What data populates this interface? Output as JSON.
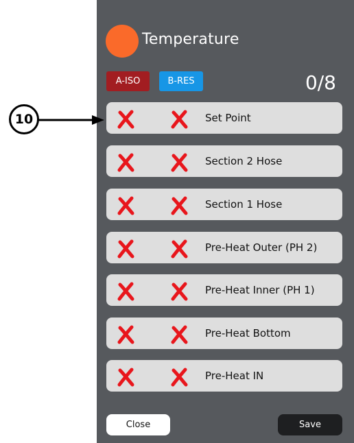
{
  "header": {
    "title": "Temperature",
    "accent_color": "#fa6a2a"
  },
  "badges": [
    {
      "label": "A-ISO",
      "color": "#a21d21"
    },
    {
      "label": "B-RES",
      "color": "#1796e6"
    }
  ],
  "counter": "0/8",
  "rows": [
    {
      "label": "Set Point",
      "a_status": "x-icon",
      "b_status": "x-icon"
    },
    {
      "label": "Section 2 Hose",
      "a_status": "x-icon",
      "b_status": "x-icon"
    },
    {
      "label": "Section 1 Hose",
      "a_status": "x-icon",
      "b_status": "x-icon"
    },
    {
      "label": "Pre-Heat Outer (PH 2)",
      "a_status": "x-icon",
      "b_status": "x-icon"
    },
    {
      "label": "Pre-Heat Inner (PH 1)",
      "a_status": "x-icon",
      "b_status": "x-icon"
    },
    {
      "label": "Pre-Heat Bottom",
      "a_status": "x-icon",
      "b_status": "x-icon"
    },
    {
      "label": "Pre-Heat IN",
      "a_status": "x-icon",
      "b_status": "x-icon"
    }
  ],
  "footer": {
    "close_label": "Close",
    "save_label": "Save"
  },
  "callout": {
    "number": "10"
  },
  "colors": {
    "panel": "#56595d",
    "row": "#dedede",
    "cross": "#e8161c"
  }
}
